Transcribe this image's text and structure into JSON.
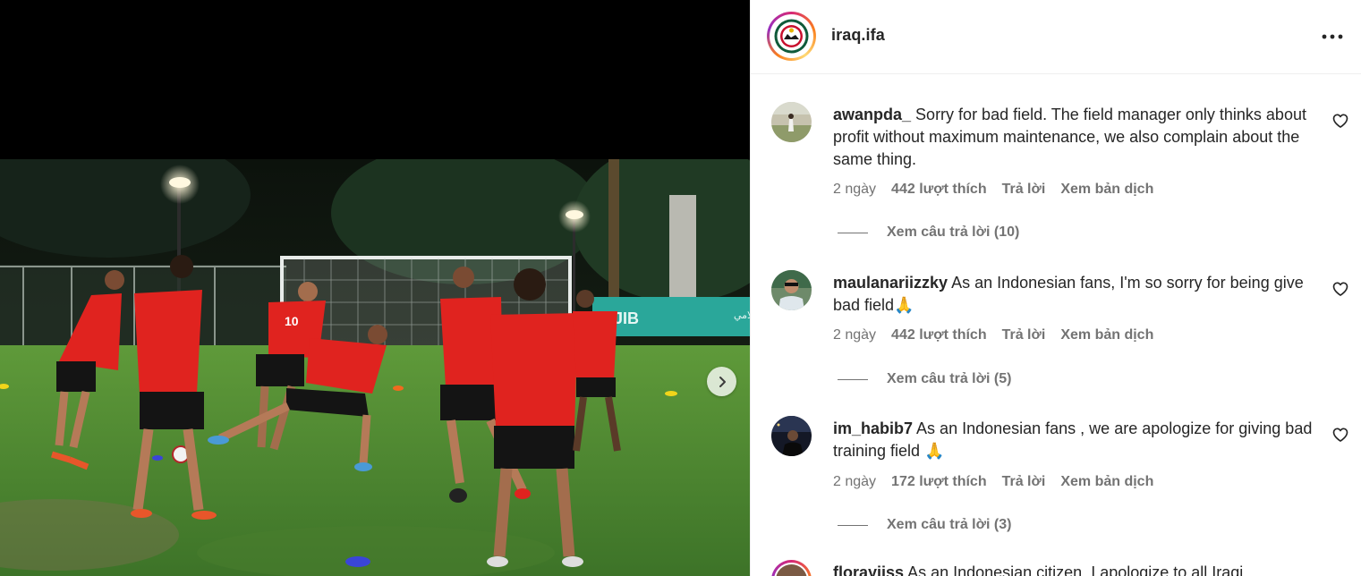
{
  "post": {
    "account": "iraq.ifa",
    "photo_alt": "Iraq national team players training on a football pitch at night",
    "banner_text_latin": "JIB",
    "banner_text_arabic": "مصرف الجنوب الإسلامي",
    "colors": {
      "kit_red": "#e0231f",
      "grass": "#4f8a2f",
      "link_gray": "#737373"
    }
  },
  "icons": {
    "more": "more-horizontal-icon",
    "like": "heart-icon",
    "next": "chevron-right-icon"
  },
  "comments": [
    {
      "username": "awanpda_",
      "text": "Sorry for bad field. The field manager only thinks about profit without maximum maintenance, we also complain about the same thing.",
      "time": "2 ngày",
      "likes": "442 lượt thích",
      "reply": "Trả lời",
      "translate": "Xem bản dịch",
      "view_replies": "Xem câu trả lời (10)"
    },
    {
      "username": "maulanariizzky",
      "text": "As an Indonesian fans, I'm so sorry for being give bad field🙏",
      "time": "2 ngày",
      "likes": "442 lượt thích",
      "reply": "Trả lời",
      "translate": "Xem bản dịch",
      "view_replies": "Xem câu trả lời (5)"
    },
    {
      "username": "im_habib7",
      "text": "As an Indonesian fans , we are apologize for giving bad training field 🙏",
      "time": "2 ngày",
      "likes": "172 lượt thích",
      "reply": "Trả lời",
      "translate": "Xem bản dịch",
      "view_replies": "Xem câu trả lời (3)"
    },
    {
      "username": "florayjiss",
      "text": "As an Indonesian citizen, I apologize to all Iraqi"
    }
  ]
}
